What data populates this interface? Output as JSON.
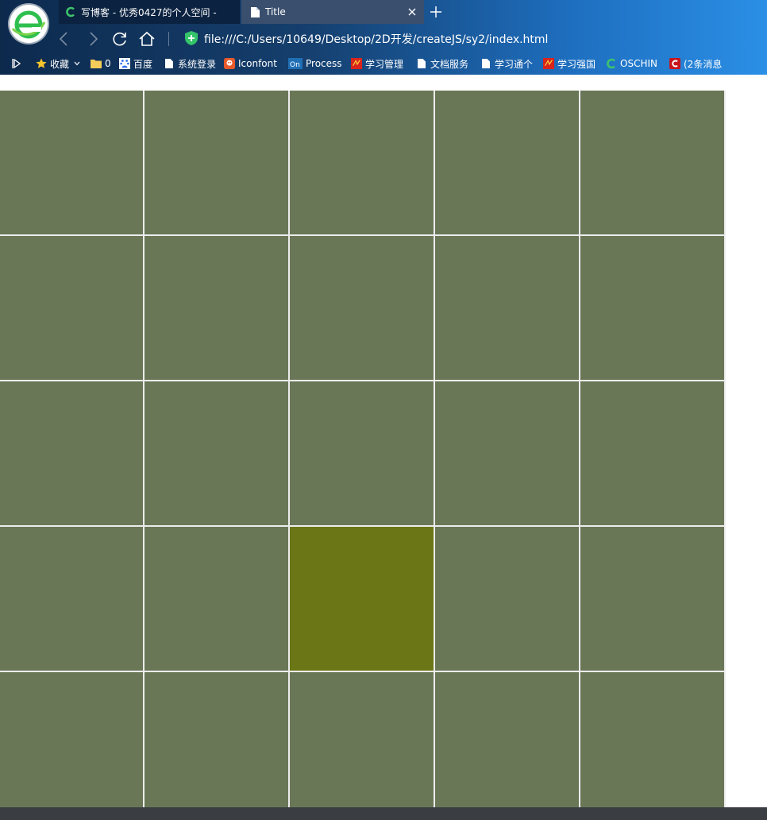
{
  "browser": {
    "tabs": [
      {
        "title": "写博客 - 优秀0427的个人空间 -",
        "icon": "csdn-icon",
        "active": false
      },
      {
        "title": "Title",
        "icon": "file-icon",
        "active": true
      }
    ],
    "url": "file:///C:/Users/10649/Desktop/2D开发/createJS/sy2/index.html",
    "bookmarks": [
      {
        "label": "收藏",
        "icon": "star-icon"
      },
      {
        "label": "0",
        "icon": "folder-icon"
      },
      {
        "label": "百度",
        "icon": "baidu-icon"
      },
      {
        "label": "系统登录",
        "icon": "file-icon"
      },
      {
        "label": "Iconfont",
        "icon": "iconfont-icon"
      },
      {
        "label": "Process",
        "icon": "processon-icon"
      },
      {
        "label": "学习管理",
        "icon": "xuexi-icon"
      },
      {
        "label": "文档服务",
        "icon": "file-icon"
      },
      {
        "label": "学习通个",
        "icon": "file-icon"
      },
      {
        "label": "学习强国",
        "icon": "xuexi-icon"
      },
      {
        "label": "OSCHIN",
        "icon": "oschina-icon"
      },
      {
        "label": "(2条消息",
        "icon": "csdn-icon"
      }
    ]
  },
  "grid": {
    "rows": 5,
    "cols": 5,
    "active_cell": {
      "row": 3,
      "col": 2
    },
    "colors": {
      "cell": "#6a7757",
      "active": "#6b7616",
      "gap": "#ececec"
    }
  }
}
